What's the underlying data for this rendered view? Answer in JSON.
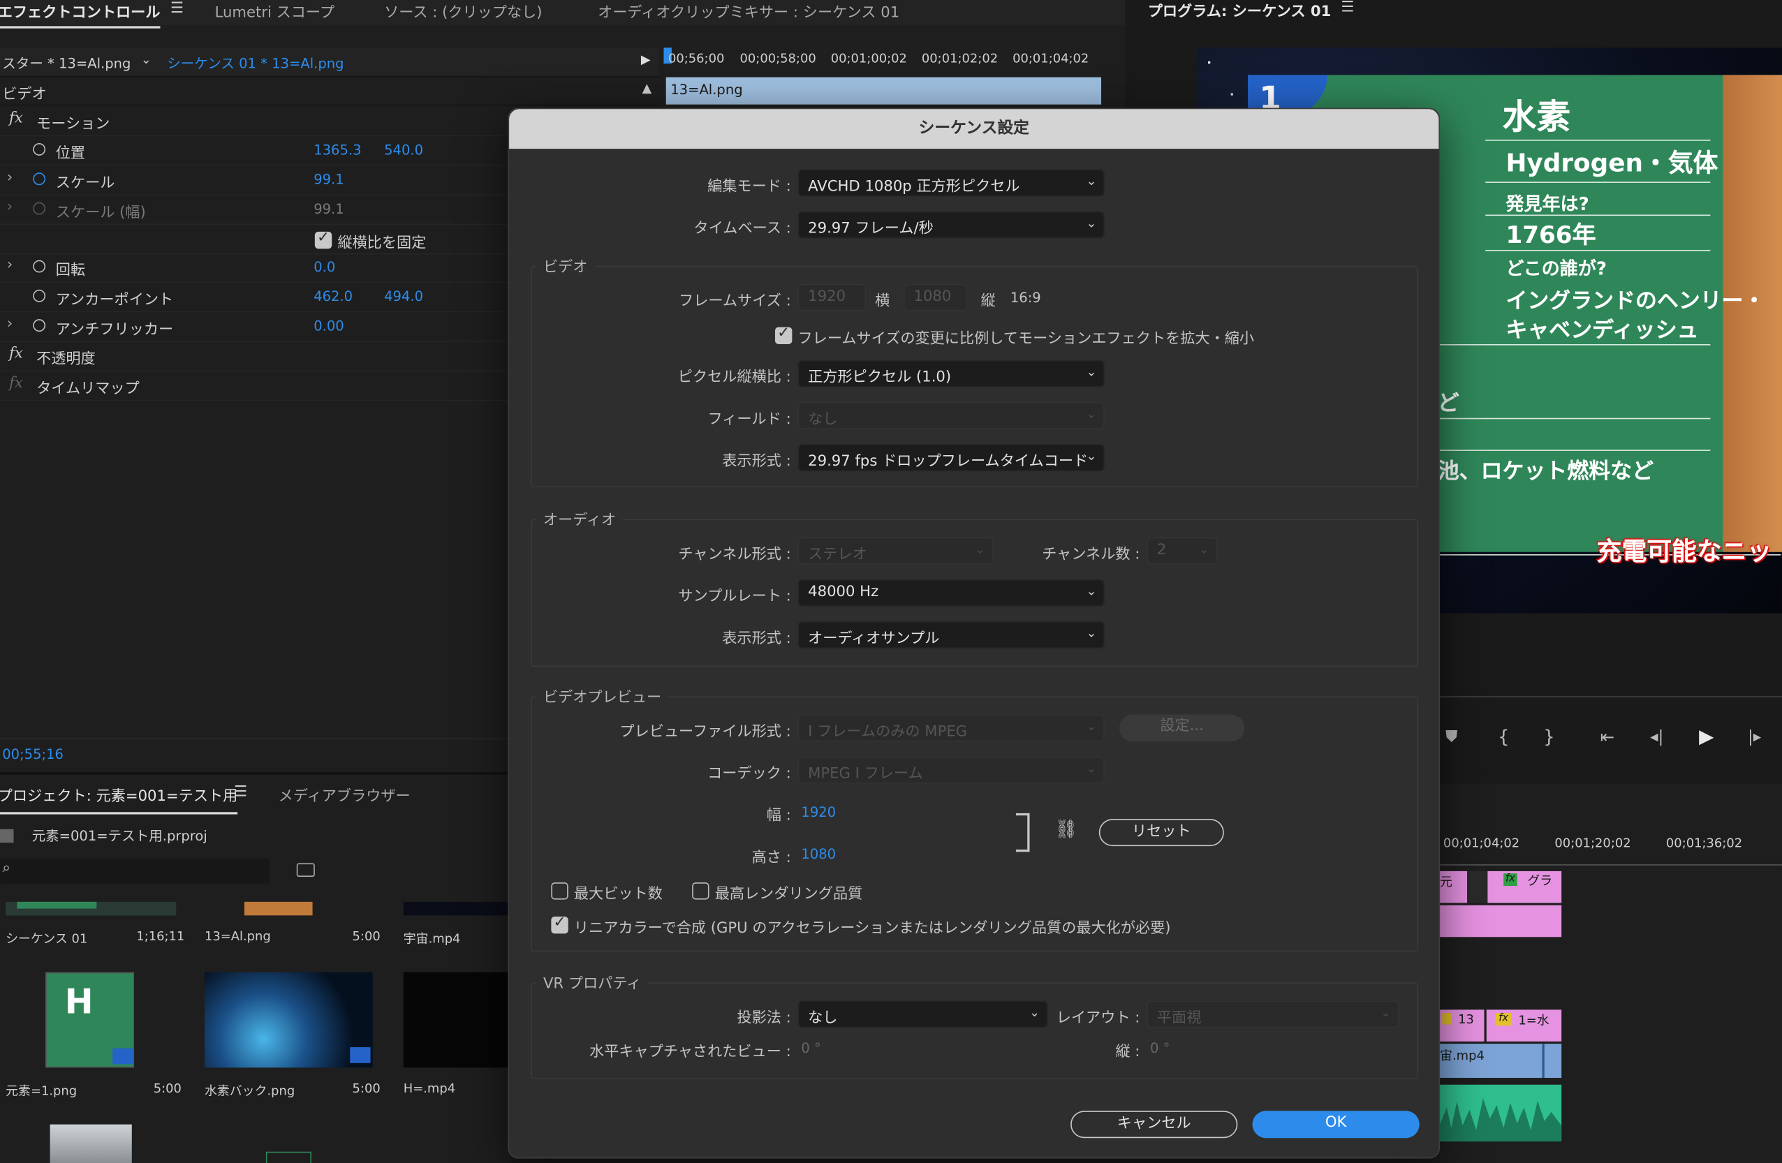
{
  "effect_controls": {
    "tabs": [
      "エフェクトコントロール",
      "Lumetri スコープ",
      "ソース : (クリップなし)",
      "オーディオクリップミキサー : シーケンス 01"
    ],
    "master_label": "スター * 13=Al.png",
    "sequence_label": "シーケンス 01 * 13=Al.png",
    "ruler_ticks": [
      "00;56;00",
      "00;00;58;00",
      "00;01;00;02",
      "00;01;02;02",
      "00;01;04;02"
    ],
    "clip_name": "13=Al.png",
    "video_header": "ビデオ",
    "motion": "モーション",
    "position_label": "位置",
    "position_x": "1365.3",
    "position_y": "540.0",
    "scale_label": "スケール",
    "scale_value": "99.1",
    "scale_width_label": "スケール (幅)",
    "scale_width_value": "99.1",
    "uniform_scale_label": "縦横比を固定",
    "rotation_label": "回転",
    "rotation_value": "0.0",
    "anchor_label": "アンカーポイント",
    "anchor_x": "462.0",
    "anchor_y": "494.0",
    "antiflicker_label": "アンチフリッカー",
    "antiflicker_value": "0.00",
    "opacity_label": "不透明度",
    "time_remap_label": "タイムリマップ",
    "timecode": "00;55;16"
  },
  "project": {
    "tabs": [
      "プロジェクト: 元素=001=テスト用",
      "メディアブラウザー"
    ],
    "file": "元素=001=テスト用.prproj",
    "items": [
      {
        "name": "シーケンス 01",
        "duration": "1;16;11"
      },
      {
        "name": "13=Al.png",
        "duration": "5:00"
      },
      {
        "name": "宇宙.mp4",
        "duration": ""
      },
      {
        "name": "元素=1.png",
        "duration": "5:00"
      },
      {
        "name": "水素バック.png",
        "duration": "5:00"
      },
      {
        "name": "H=.mp4",
        "duration": ""
      }
    ]
  },
  "program": {
    "title": "プログラム: シーケンス 01",
    "slide": {
      "number": "1",
      "title": "水素",
      "subtitle": "Hydrogen・気体",
      "q1": "発見年は?",
      "a1": "1766年",
      "q2": "どこの誰が?",
      "a2_line1": "イングランドのヘンリー・",
      "a2_line2": "キャベンディッシュ",
      "fragment1": "ど",
      "fragment2": "池、ロケット燃料など",
      "banner": "充電可能なニッ"
    }
  },
  "timeline": {
    "ticks": [
      "00;01;04;02",
      "00;01;20;02",
      "00;01;36;02"
    ],
    "clips": [
      "元",
      "グラ",
      "13",
      "1=水",
      "宙.mp4"
    ]
  },
  "dialog": {
    "title": "シーケンス設定",
    "edit_mode_label": "編集モード :",
    "edit_mode": "AVCHD 1080p 正方形ピクセル",
    "timebase_label": "タイムベース :",
    "timebase": "29.97 フレーム/秒",
    "video_group": "ビデオ",
    "frame_size_label": "フレームサイズ :",
    "frame_w": "1920",
    "frame_w_unit": "横",
    "frame_h": "1080",
    "frame_h_unit": "縦",
    "aspect": "16:9",
    "scale_motion_label": "フレームサイズの変更に比例してモーションエフェクトを拡大・縮小",
    "pixel_aspect_label": "ピクセル縦横比 :",
    "pixel_aspect": "正方形ピクセル (1.0)",
    "fields_label": "フィールド :",
    "fields": "なし",
    "display_format_label": "表示形式 :",
    "display_format": "29.97 fps ドロップフレームタイムコード",
    "audio_group": "オーディオ",
    "channel_format_label": "チャンネル形式 :",
    "channel_format": "ステレオ",
    "channel_count_label": "チャンネル数 :",
    "channel_count": "2",
    "sample_rate_label": "サンプルレート :",
    "sample_rate": "48000 Hz",
    "audio_display_label": "表示形式 :",
    "audio_display": "オーディオサンプル",
    "preview_group": "ビデオプレビュー",
    "preview_format_label": "プレビューファイル形式 :",
    "preview_format": "I フレームのみの MPEG",
    "settings_button": "設定...",
    "codec_label": "コーデック :",
    "codec": "MPEG I フレーム",
    "width_label": "幅 :",
    "width": "1920",
    "height_label": "高さ :",
    "height": "1080",
    "reset_button": "リセット",
    "max_bit_depth": "最大ビット数",
    "max_render_quality": "最高レンダリング品質",
    "linear_color": "リニアカラーで合成 (GPU のアクセラレーションまたはレンダリング品質の最大化が必要)",
    "vr_group": "VR プロパティ",
    "projection_label": "投影法 :",
    "projection": "なし",
    "layout_label": "レイアウト :",
    "layout": "平面視",
    "h_view_label": "水平キャプチャされたビュー :",
    "h_view": "0 °",
    "v_label": "縦 :",
    "v_view": "0 °",
    "cancel": "キャンセル",
    "ok": "OK"
  }
}
